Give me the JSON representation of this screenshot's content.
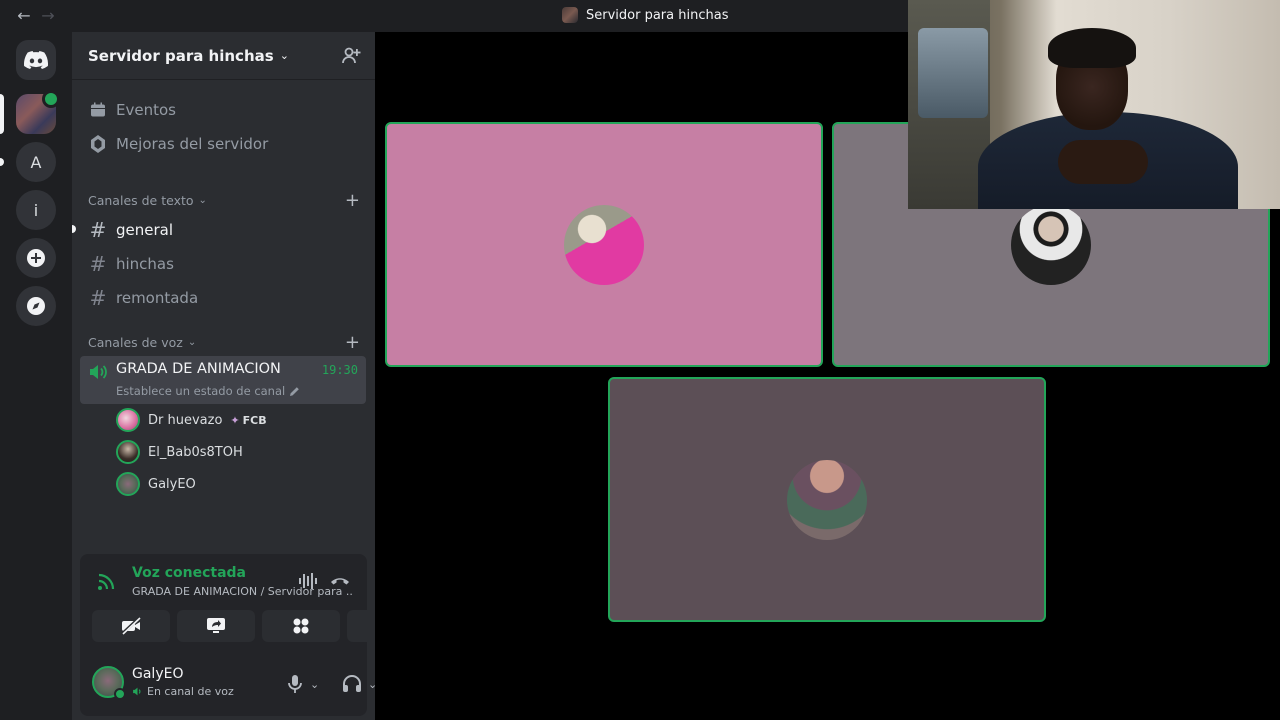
{
  "titlebar": {
    "back_icon": "arrow-left-icon",
    "forward_icon": "arrow-right-icon",
    "title": "Servidor para hinchas"
  },
  "rail": {
    "home_icon": "discord-logo-icon",
    "servers": [
      {
        "label": "",
        "kind": "image"
      },
      {
        "label": "A",
        "kind": "letter"
      },
      {
        "label": "i",
        "kind": "letter"
      }
    ],
    "add_icon": "add-server-icon",
    "discover_icon": "compass-icon"
  },
  "sidebar": {
    "server_name": "Servidor para hinchas",
    "nav": [
      {
        "label": "Eventos",
        "icon": "calendar-icon"
      },
      {
        "label": "Mejoras del servidor",
        "icon": "boost-icon"
      }
    ],
    "text_category": "Canales de texto",
    "text_channels": [
      "general",
      "hinchas",
      "remontada"
    ],
    "voice_category": "Canales de voz",
    "voice_channel": {
      "name": "GRADA DE ANIMACION",
      "time": "19:30",
      "status_placeholder": "Establece un estado de canal"
    },
    "voice_users": [
      {
        "name": "Dr huevazo",
        "tag": "FCB"
      },
      {
        "name": "El_Bab0s8TOH",
        "tag": ""
      },
      {
        "name": "GalyEO",
        "tag": ""
      }
    ]
  },
  "voice_panel": {
    "title": "Voz conectada",
    "subtitle": "GRADA DE ANIMACION / Servidor para ..."
  },
  "user_panel": {
    "name": "GalyEO",
    "status": "En canal de voz"
  },
  "colors": {
    "accent_green": "#23a559",
    "tile1": "#c67fa4",
    "tile2": "#7d757c",
    "tile3": "#5c4f56"
  }
}
